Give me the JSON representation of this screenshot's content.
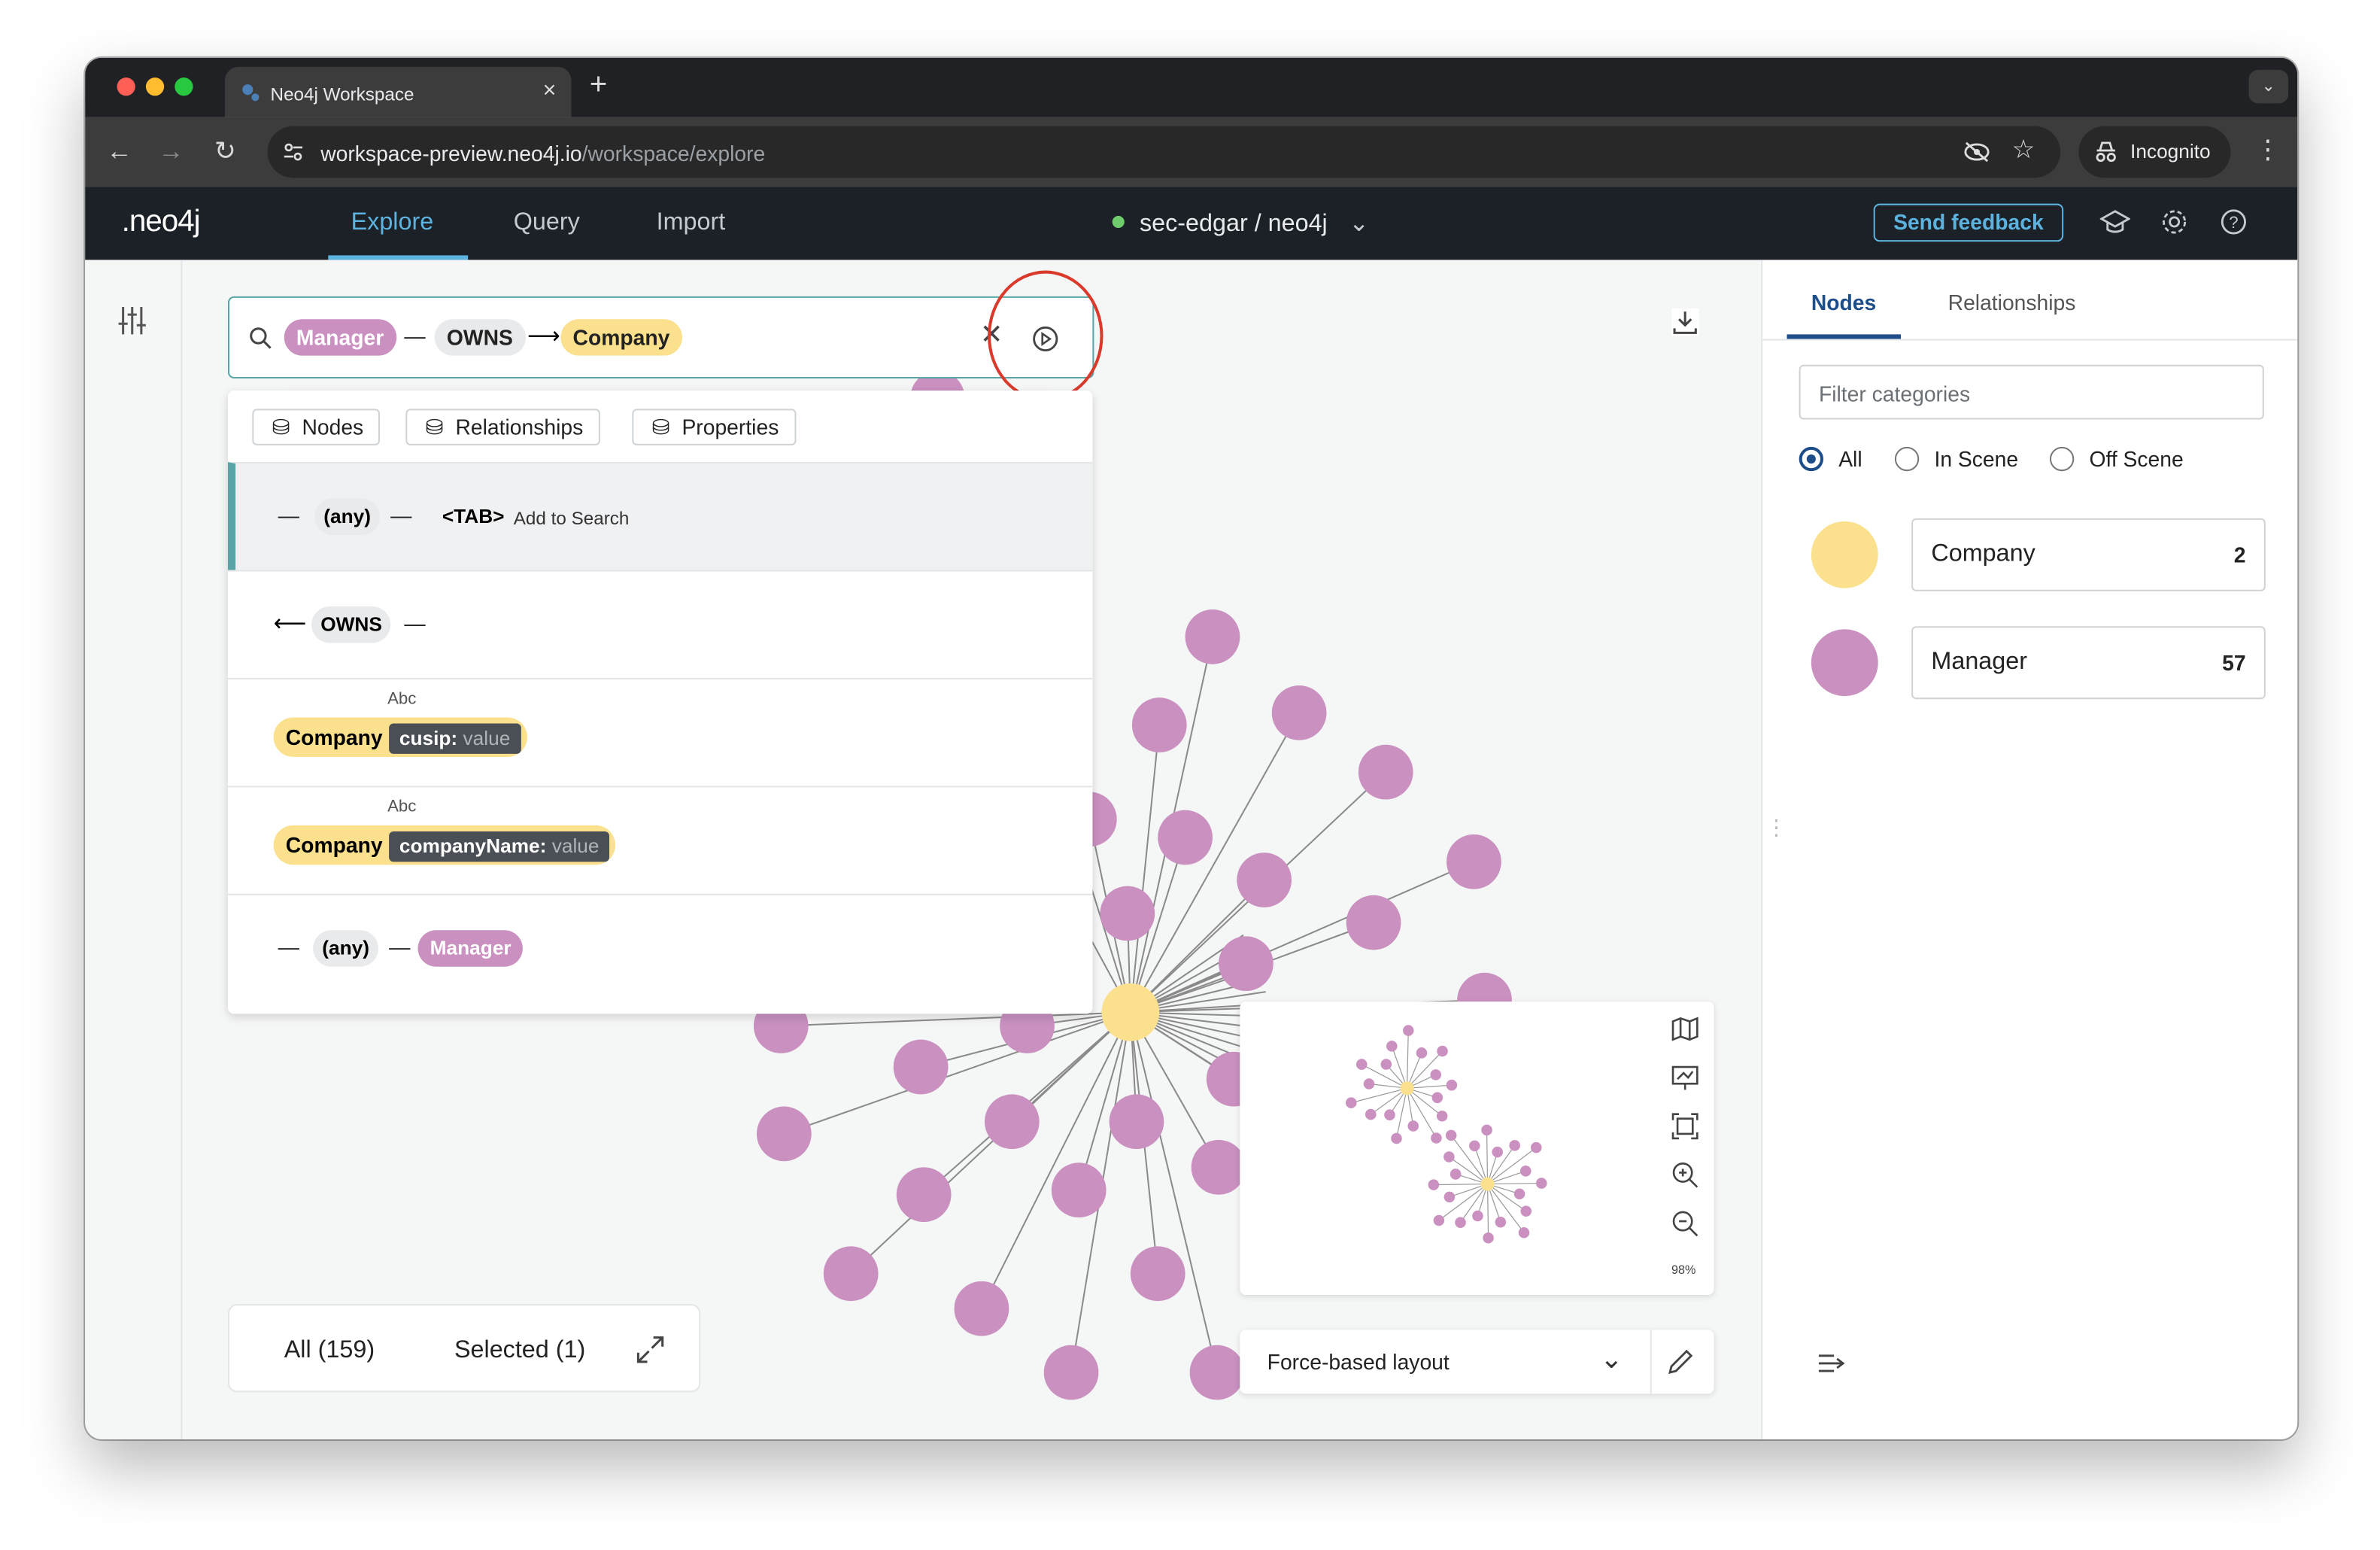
{
  "browser": {
    "tab_title": "Neo4j Workspace",
    "new_tab": "+",
    "close_tab": "×",
    "url_host": "workspace-preview.neo4j.io",
    "url_path": "/workspace/explore",
    "incognito_label": "Incognito"
  },
  "app": {
    "logo": ".neo4j",
    "nav": [
      "Explore",
      "Query",
      "Import"
    ],
    "active_nav": "Explore",
    "database": "sec-edgar / neo4j",
    "feedback": "Send feedback"
  },
  "search": {
    "pattern": {
      "start_label": "Manager",
      "dash": "—",
      "relationship": "OWNS",
      "arrow": "⟶",
      "end_label": "Company"
    },
    "filters": [
      "Nodes",
      "Relationships",
      "Properties"
    ],
    "suggestions": {
      "any_prefix": "—",
      "any_label": "(any)",
      "tab_hint": "<TAB>",
      "tab_hint_text": "Add to Search",
      "owns_left": "⟵",
      "owns_label": "OWNS",
      "abc": "Abc",
      "company": "Company",
      "cusip_key": "cusip:",
      "value": "value",
      "company_name_key": "companyName:",
      "manager": "Manager"
    }
  },
  "bottom": {
    "all": "All (159)",
    "selected": "Selected (1)"
  },
  "minimap": {
    "zoom": "98%"
  },
  "layout": {
    "selected": "Force-based layout"
  },
  "right_panel": {
    "tabs": [
      "Nodes",
      "Relationships"
    ],
    "filter_placeholder": "Filter categories",
    "radios": [
      "All",
      "In Scene",
      "Off Scene"
    ],
    "categories": [
      {
        "name": "Company",
        "count": "2",
        "color": "#fbe18d"
      },
      {
        "name": "Manager",
        "count": "57",
        "color": "#c990c0"
      }
    ]
  },
  "colors": {
    "company": "#fbe18d",
    "manager": "#c990c0",
    "accent": "#5db3e0",
    "highlight": "#d93a2b"
  }
}
